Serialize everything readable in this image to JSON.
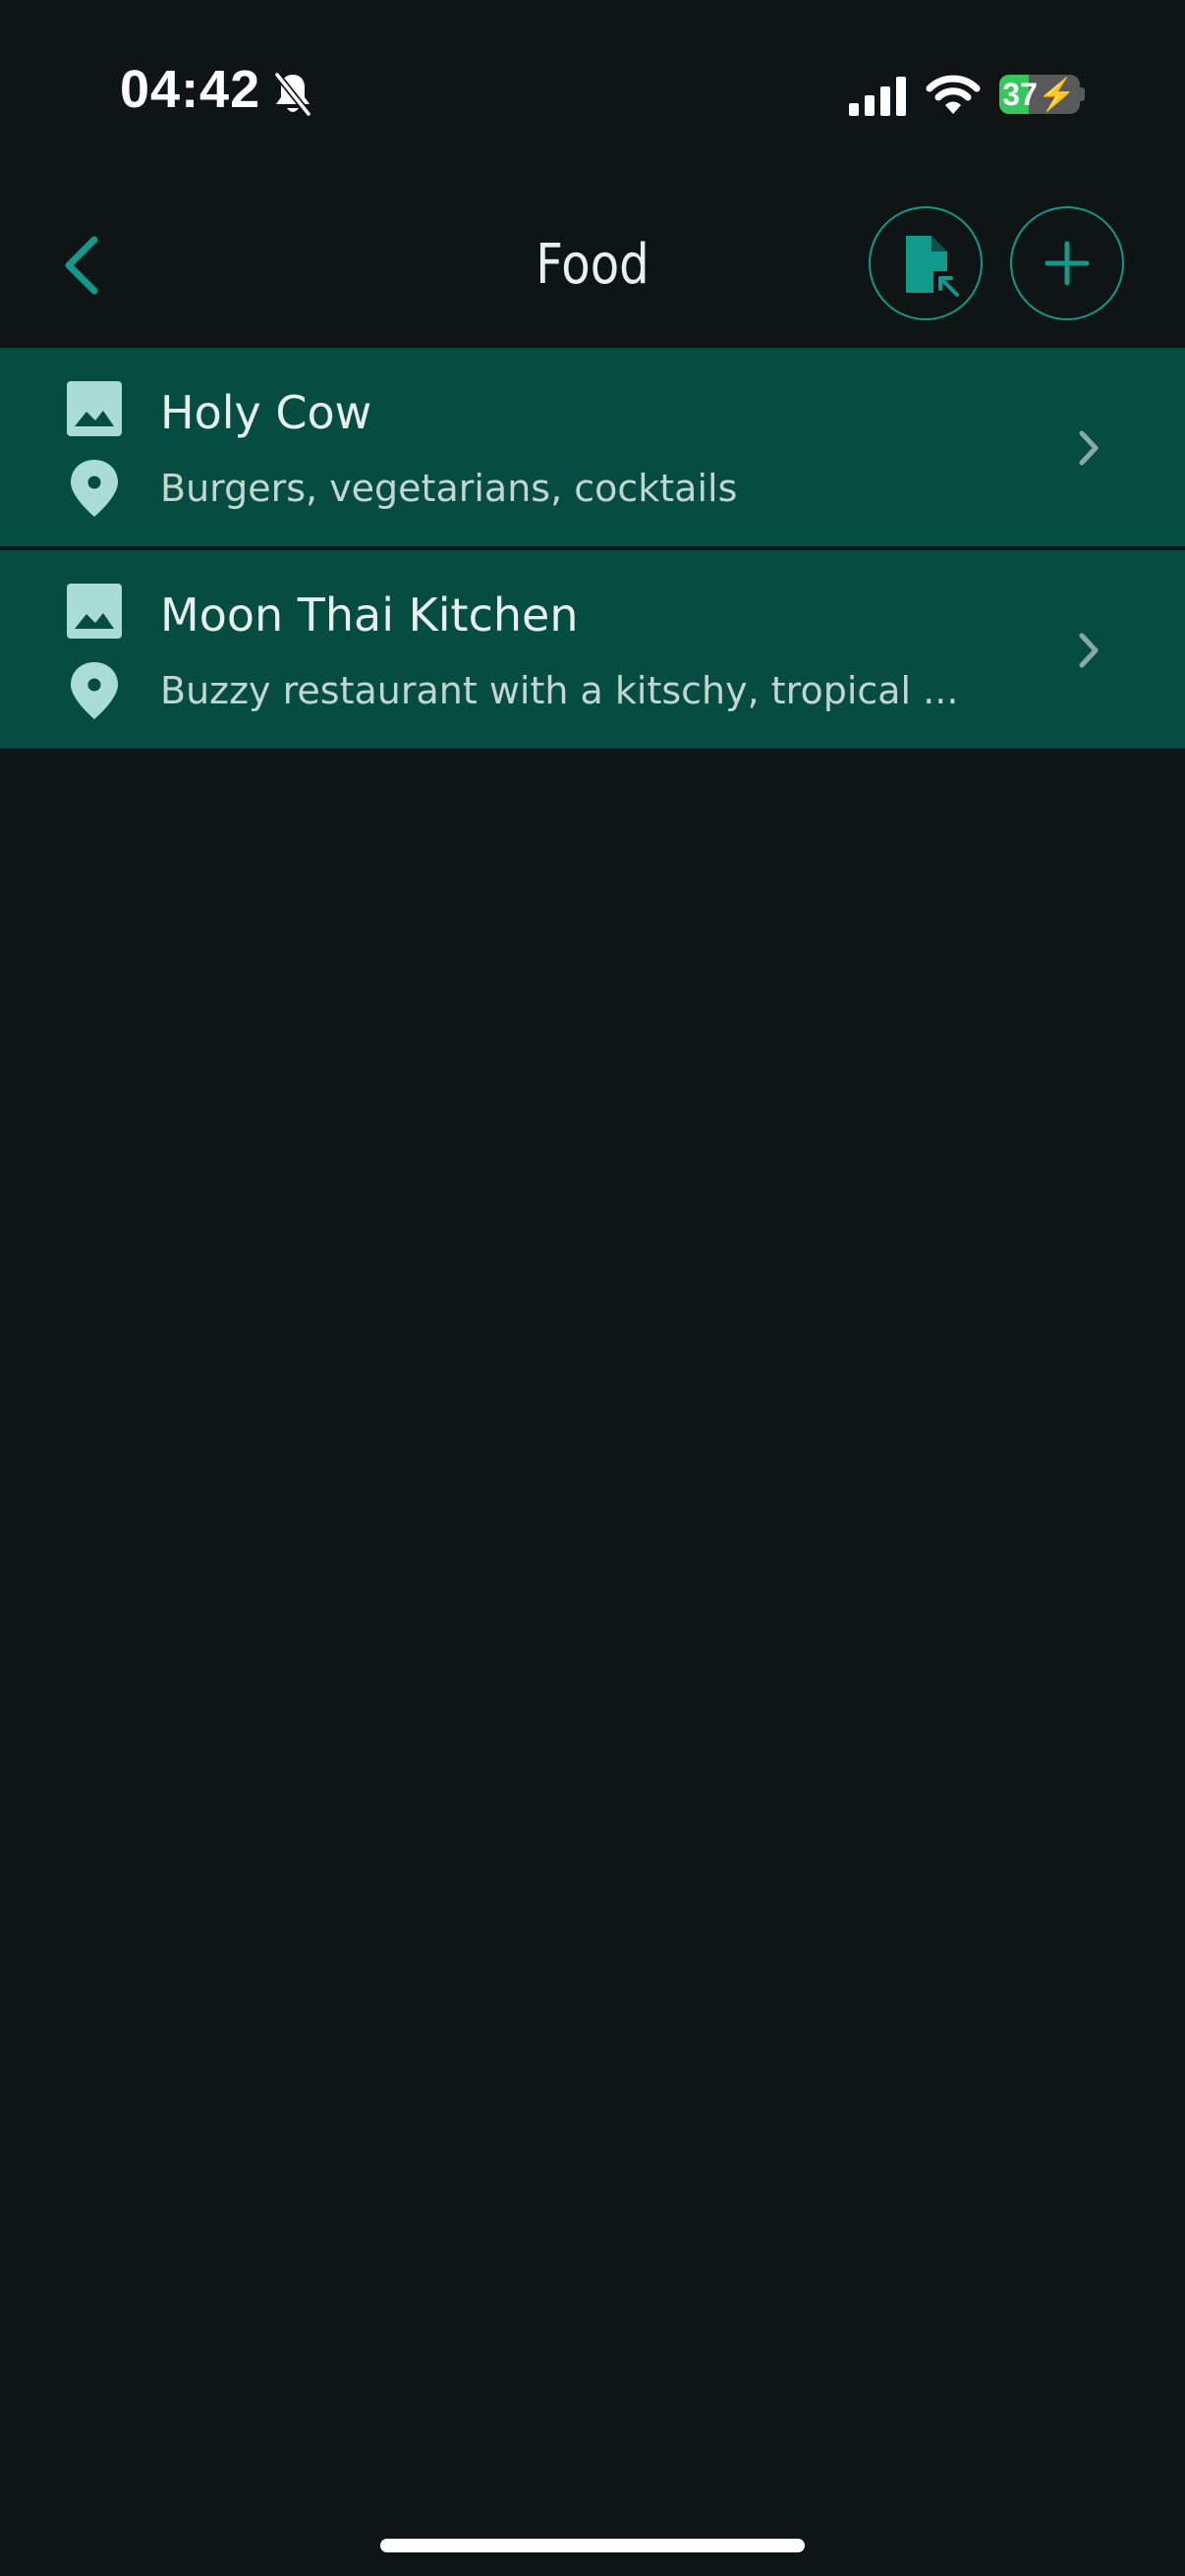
{
  "status_bar": {
    "time": "04:42",
    "battery_percent": 37,
    "battery_label": "37",
    "icons": [
      "bell-muted-icon",
      "cellular-signal-icon",
      "wifi-icon",
      "battery-charging-icon"
    ]
  },
  "nav": {
    "title": "Food",
    "back_icon": "chevron-left-icon",
    "import_icon": "file-import-icon",
    "add_icon": "plus-icon"
  },
  "items": [
    {
      "title": "Holy Cow",
      "subtitle": "Burgers, vegetarians, cocktails",
      "image_icon": "image-icon",
      "location_icon": "map-pin-icon"
    },
    {
      "title": "Moon Thai Kitchen",
      "subtitle": "Buzzy restaurant with a kitschy, tropical ...",
      "image_icon": "image-icon",
      "location_icon": "map-pin-icon"
    }
  ],
  "colors": {
    "background": "#0f1515",
    "accent": "#0f9a8c",
    "row_background": "#044d40",
    "icon_tint": "#a9dcd6",
    "battery_green": "#34c759"
  }
}
